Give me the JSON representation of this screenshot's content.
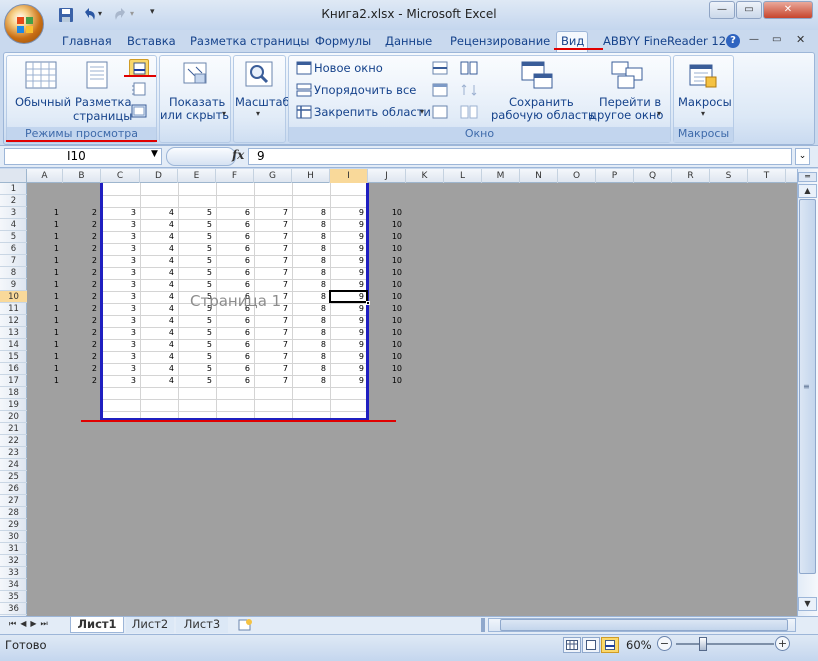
{
  "window": {
    "title": "Книга2.xlsx - Microsoft Excel"
  },
  "ribbon_tabs": [
    "Главная",
    "Вставка",
    "Разметка страницы",
    "Формулы",
    "Данные",
    "Рецензирование",
    "Вид",
    "ABBYY FineReader 12"
  ],
  "active_tab": "Вид",
  "groups": {
    "views": {
      "label": "Режимы просмотра книги",
      "normal": "Обычный",
      "page_layout_1": "Разметка",
      "page_layout_2": "страницы"
    },
    "show": {
      "line1": "Показать",
      "line2": "или скрыть"
    },
    "zoom": {
      "label": "Масштаб"
    },
    "window": {
      "label": "Окно",
      "new_window": "Новое окно",
      "arrange_all": "Упорядочить все",
      "freeze_panes": "Закрепить области",
      "save_ws_1": "Сохранить",
      "save_ws_2": "рабочую область",
      "switch_1": "Перейти в",
      "switch_2": "другое окно"
    },
    "macros": {
      "label": "Макросы",
      "button": "Макросы"
    }
  },
  "formula_bar": {
    "name_box": "I10",
    "fx": "fx",
    "value": "9"
  },
  "columns": [
    "A",
    "B",
    "C",
    "D",
    "E",
    "F",
    "G",
    "H",
    "I",
    "J",
    "K",
    "L",
    "M",
    "N",
    "O",
    "P",
    "Q",
    "R",
    "S",
    "T"
  ],
  "rows": [
    "1",
    "2",
    "3",
    "4",
    "5",
    "6",
    "7",
    "8",
    "9",
    "10",
    "11",
    "12",
    "13",
    "14",
    "15",
    "16",
    "17",
    "18",
    "19",
    "20",
    "21",
    "22",
    "23",
    "24",
    "25",
    "26",
    "27",
    "28",
    "29",
    "30",
    "31",
    "32",
    "33",
    "34",
    "35",
    "36"
  ],
  "row_values": [
    "1",
    "2",
    "3",
    "4",
    "5",
    "6",
    "7",
    "8",
    "9",
    "10"
  ],
  "data_rows_count_label": "rows 3-17",
  "page_watermark": "Страница 1",
  "sheets": [
    "Лист1",
    "Лист2",
    "Лист3"
  ],
  "active_sheet": "Лист1",
  "status": {
    "ready": "Готово",
    "zoom": "60%"
  },
  "colors": {
    "accent_red": "#e00000",
    "page_border": "#1f1fc0",
    "ribbon": "#dce8f6"
  }
}
